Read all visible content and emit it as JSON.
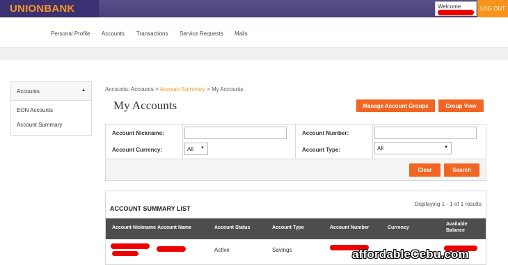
{
  "header": {
    "logo": "UNIONBANK",
    "welcome": "Welcome",
    "logout": "LOG OUT"
  },
  "nav": {
    "items": [
      "Personal Profile",
      "Accounts",
      "Transactions",
      "Service Requests",
      "Mails"
    ]
  },
  "sidebar": {
    "title": "Accounts",
    "items": [
      "EON Accounts",
      "Account Summary"
    ]
  },
  "breadcrumb": {
    "part1": "Accounts: Accounts > ",
    "part2": "Account Summary",
    "part3": " > My Accounts"
  },
  "page": {
    "title": "My Accounts",
    "manage_groups": "Manage Account Groups",
    "group_view": "Group View"
  },
  "filter": {
    "nickname_label": "Account Nickname:",
    "number_label": "Account Number:",
    "currency_label": "Account Currency:",
    "type_label": "Account Type:",
    "currency_value": "All",
    "type_value": "All",
    "clear": "Clear",
    "search": "Search"
  },
  "summary": {
    "title": "ACCOUNT SUMMARY LIST",
    "count": "Displaying 1 - 1 of 1 results",
    "columns": [
      "Account Nickname",
      "Account Name",
      "Account Status",
      "Account Type",
      "Account Number",
      "Currency",
      "Available",
      "Balance"
    ],
    "row": {
      "status": "Active",
      "type": "Savings"
    }
  },
  "watermark": "affordableCebu.com",
  "colors": {
    "brand_orange": "#f7941d",
    "button_orange": "#f26522",
    "header_purple": "#4a3f7a",
    "redaction": "#ee0000"
  }
}
